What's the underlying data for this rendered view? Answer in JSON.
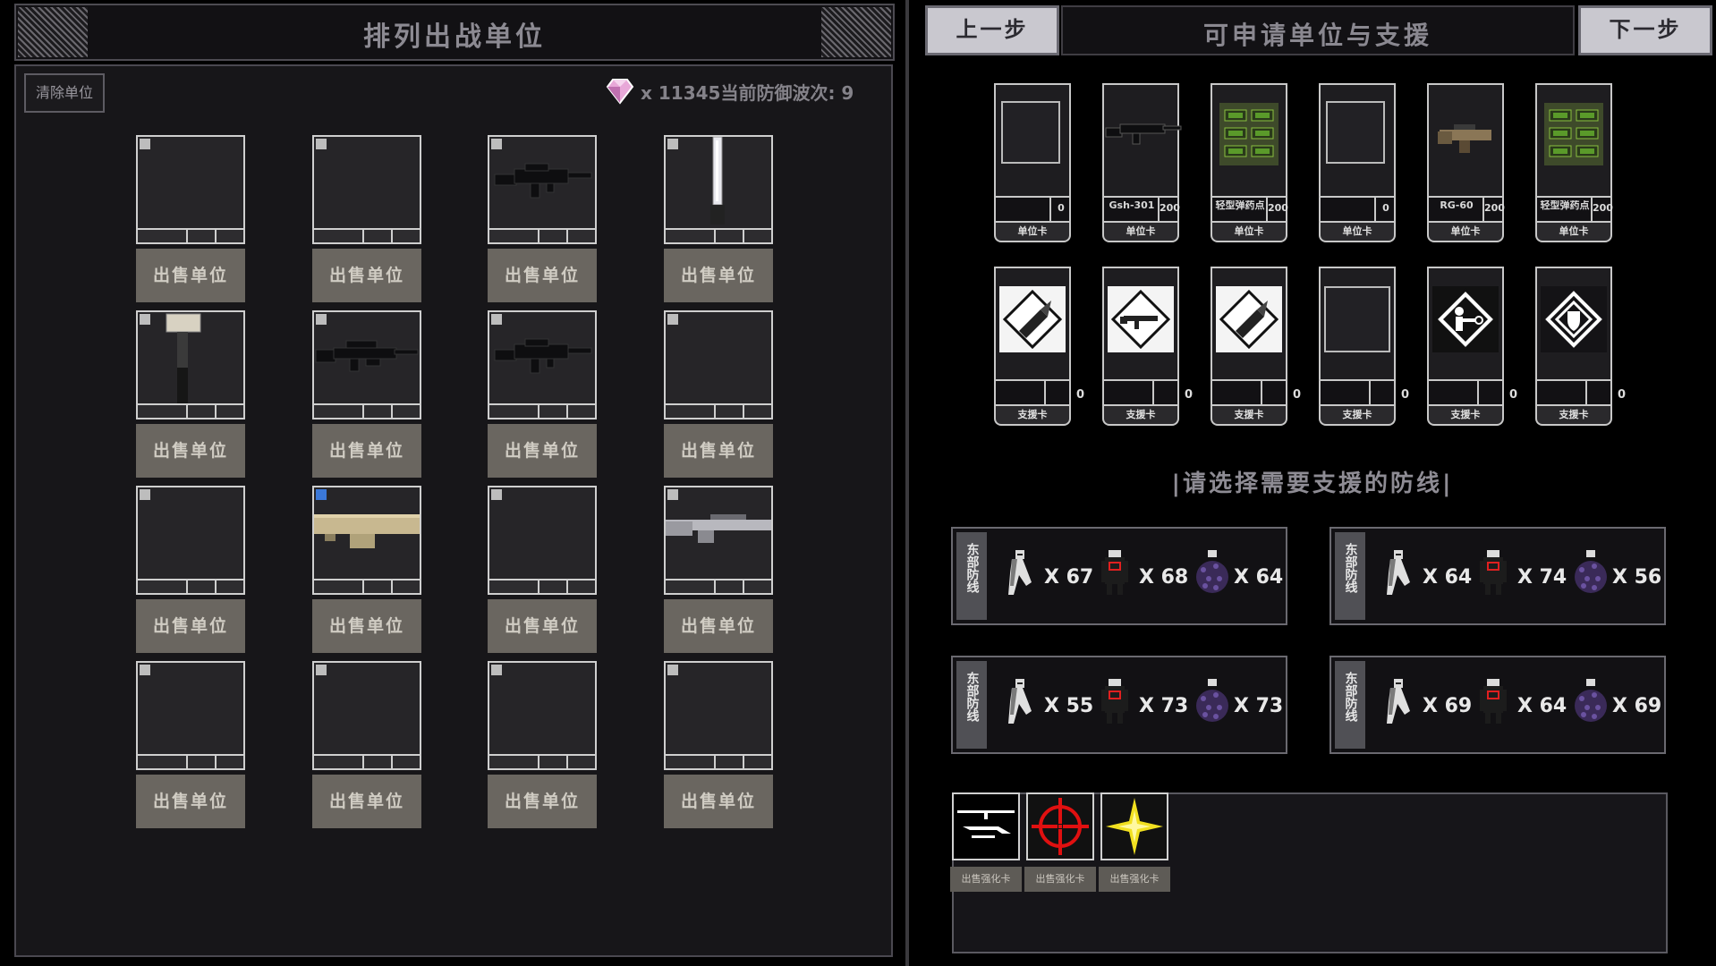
{
  "left": {
    "title": "排列出战单位",
    "clear_button": "清除单位",
    "status": "x 11345当前防御波次: 9",
    "sell_label": "出售单位",
    "slots": [
      {
        "icon": "empty",
        "corner": "gray"
      },
      {
        "icon": "empty",
        "corner": "gray"
      },
      {
        "icon": "rifle-icon",
        "corner": "gray"
      },
      {
        "icon": "sword-icon",
        "corner": "gray"
      },
      {
        "icon": "hammer-icon",
        "corner": "gray"
      },
      {
        "icon": "sniper-rifle-icon",
        "corner": "gray"
      },
      {
        "icon": "rifle-icon",
        "corner": "gray"
      },
      {
        "icon": "empty",
        "corner": "gray"
      },
      {
        "icon": "empty",
        "corner": "gray"
      },
      {
        "icon": "launcher-icon",
        "corner": "blue"
      },
      {
        "icon": "empty",
        "corner": "gray"
      },
      {
        "icon": "railgun-icon",
        "corner": "gray"
      },
      {
        "icon": "empty",
        "corner": "gray"
      },
      {
        "icon": "empty",
        "corner": "gray"
      },
      {
        "icon": "empty",
        "corner": "gray"
      },
      {
        "icon": "empty",
        "corner": "gray"
      }
    ]
  },
  "right": {
    "prev_button": "上一步",
    "next_button": "下一步",
    "title": "可申请单位与支援",
    "unit_cards": [
      {
        "label": "",
        "count": "0",
        "tab": "单位卡",
        "icon": "empty"
      },
      {
        "label": "Gsh-301",
        "count": "200",
        "tab": "单位卡",
        "icon": "rifle-icon"
      },
      {
        "label": "轻型弹药点",
        "count": "200",
        "tab": "单位卡",
        "icon": "ammo-crate-icon"
      },
      {
        "label": "",
        "count": "0",
        "tab": "单位卡",
        "icon": "empty"
      },
      {
        "label": "RG-60",
        "count": "200",
        "tab": "单位卡",
        "icon": "grenade-launcher-icon"
      },
      {
        "label": "轻型弹药点",
        "count": "200",
        "tab": "单位卡",
        "icon": "ammo-crate-icon"
      }
    ],
    "support_cards": [
      {
        "count": "0",
        "tab": "支援卡",
        "icon": "bullet-sign-icon"
      },
      {
        "count": "0",
        "tab": "支援卡",
        "icon": "rifle-sign-icon"
      },
      {
        "count": "0",
        "tab": "支援卡",
        "icon": "bullet-sign-icon"
      },
      {
        "count": "0",
        "tab": "支援卡",
        "icon": "empty"
      },
      {
        "count": "0",
        "tab": "支援卡",
        "icon": "soldier-sign-icon"
      },
      {
        "count": "0",
        "tab": "支援卡",
        "icon": "shield-sign-icon"
      }
    ],
    "prompt": "|请选择需要支援的防线|",
    "defense_lines": [
      {
        "name": "东部防线",
        "counts": [
          "X 67",
          "X 68",
          "X 64"
        ]
      },
      {
        "name": "东部防线",
        "counts": [
          "X 64",
          "X 74",
          "X 56"
        ]
      },
      {
        "name": "东部防线",
        "counts": [
          "X 55",
          "X 73",
          "X 73"
        ]
      },
      {
        "name": "东部防线",
        "counts": [
          "X 69",
          "X 64",
          "X 69"
        ]
      }
    ],
    "enhance_cards": [
      {
        "icon": "helicopter-icon",
        "sell": "出售强化卡"
      },
      {
        "icon": "crosshair-icon",
        "sell": "出售强化卡"
      },
      {
        "icon": "star-burst-icon",
        "sell": "出售强化卡"
      }
    ]
  }
}
